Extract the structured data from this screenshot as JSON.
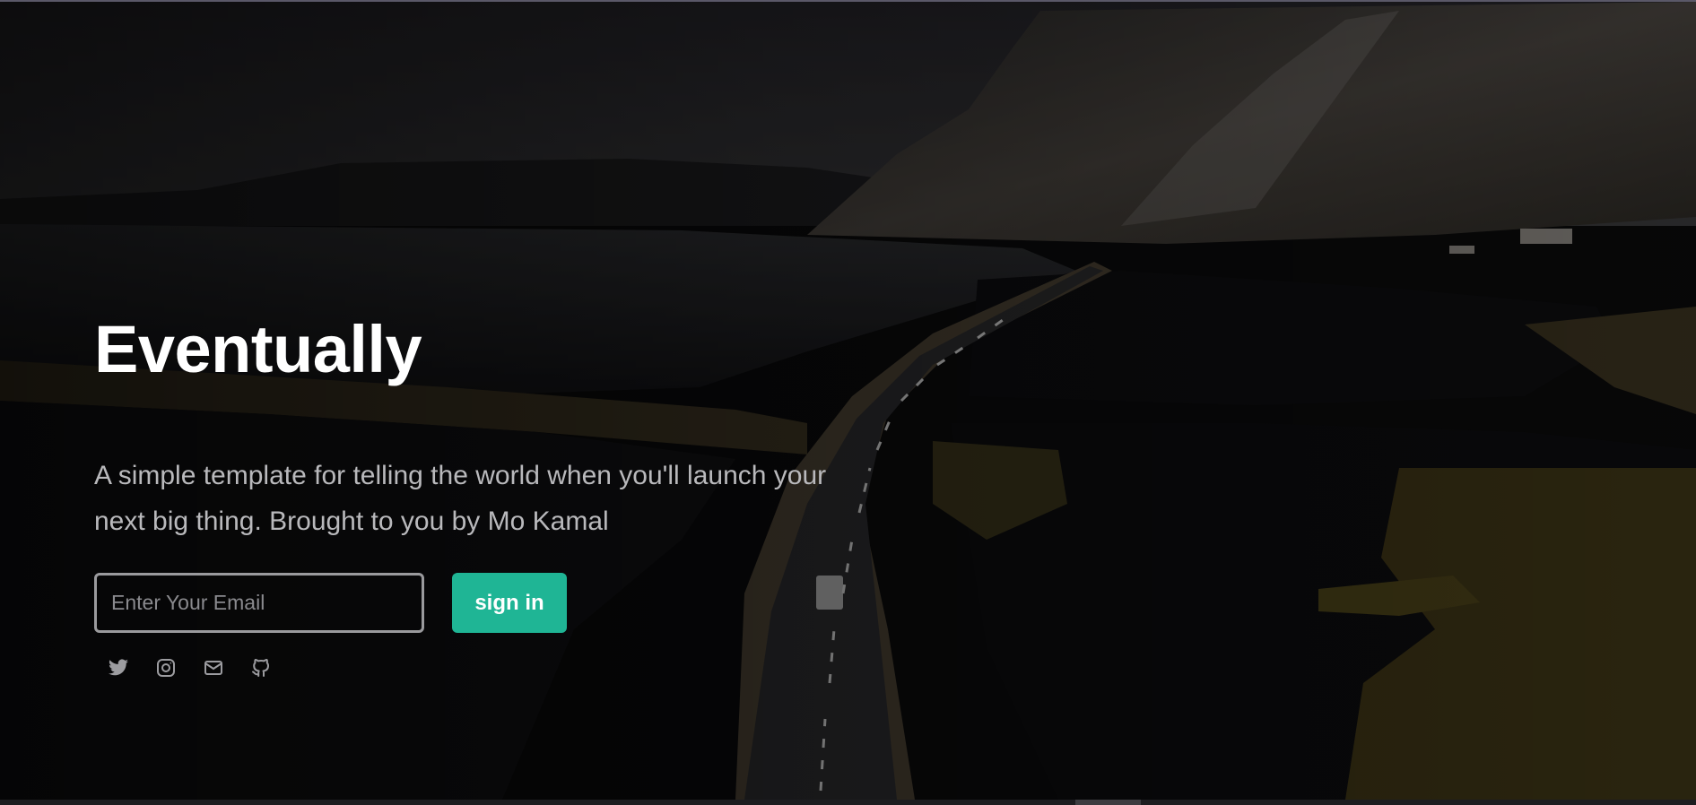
{
  "hero": {
    "title": "Eventually",
    "subtitle": "A simple template for telling the world when you'll launch your next big thing. Brought to you by Mo Kamal"
  },
  "signup": {
    "email_placeholder": "Enter Your Email",
    "email_value": "",
    "button_label": "sign in"
  },
  "social": [
    {
      "icon": "twitter-icon"
    },
    {
      "icon": "instagram-icon"
    },
    {
      "icon": "mail-icon"
    },
    {
      "icon": "github-icon"
    }
  ],
  "colors": {
    "accent": "#1fb595",
    "title": "#ffffff",
    "subtitle": "#b9b9bc",
    "icon": "#9c9ca0",
    "input_border": "#9a9a9d"
  }
}
